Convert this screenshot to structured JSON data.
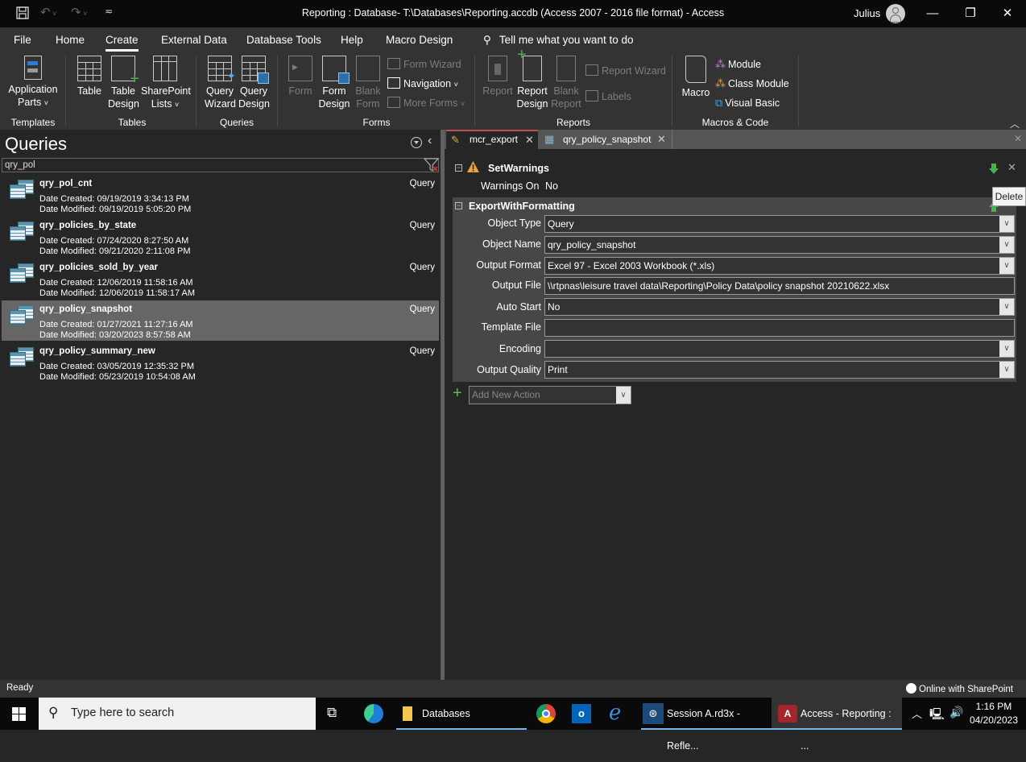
{
  "window": {
    "title": "Reporting : Database- T:\\Databases\\Reporting.accdb (Access 2007 - 2016 file format)  -  Access",
    "user": "Julius",
    "controls": {
      "minimize": "—",
      "restore": "❐",
      "close": "✕"
    }
  },
  "quick_access": {
    "save_icon": "save-icon",
    "undo_icon": "undo-icon",
    "redo_icon": "redo-icon",
    "customize_icon": "customize-qat-icon"
  },
  "ribbon_tabs": [
    {
      "label": "File",
      "active": false
    },
    {
      "label": "Home",
      "active": false
    },
    {
      "label": "Create",
      "active": true
    },
    {
      "label": "External Data",
      "active": false
    },
    {
      "label": "Database Tools",
      "active": false
    },
    {
      "label": "Help",
      "active": false
    },
    {
      "label": "Macro Design",
      "active": false
    }
  ],
  "tell_me": "Tell me what you want to do",
  "ribbon": {
    "groups": {
      "templates": "Templates",
      "tables": "Tables",
      "queries": "Queries",
      "forms": "Forms",
      "reports": "Reports",
      "macros": "Macros & Code"
    },
    "buttons": {
      "application_parts": [
        "Application",
        "Parts"
      ],
      "table": "Table",
      "table_design": [
        "Table",
        "Design"
      ],
      "sharepoint_lists": [
        "SharePoint",
        "Lists"
      ],
      "query_wizard": [
        "Query",
        "Wizard"
      ],
      "query_design": [
        "Query",
        "Design"
      ],
      "form": "Form",
      "form_design": [
        "Form",
        "Design"
      ],
      "blank_form": [
        "Blank",
        "Form"
      ],
      "form_wizard": "Form Wizard",
      "navigation": "Navigation",
      "more_forms": "More Forms",
      "report": "Report",
      "report_design": [
        "Report",
        "Design"
      ],
      "blank_report": [
        "Blank",
        "Report"
      ],
      "report_wizard": "Report Wizard",
      "labels": "Labels",
      "macro": "Macro",
      "module": "Module",
      "class_module": "Class Module",
      "visual_basic": "Visual Basic"
    }
  },
  "nav_pane": {
    "title": "Queries",
    "search_value": "qry_pol",
    "items": [
      {
        "name": "qry_pol_cnt",
        "type": "Query",
        "created": "Date Created: 09/19/2019 3:34:13 PM",
        "modified": "Date Modified: 09/19/2019 5:05:20 PM",
        "selected": false
      },
      {
        "name": "qry_policies_by_state",
        "type": "Query",
        "created": "Date Created: 07/24/2020 8:27:50 AM",
        "modified": "Date Modified: 09/21/2020 2:11:08 PM",
        "selected": false
      },
      {
        "name": "qry_policies_sold_by_year",
        "type": "Query",
        "created": "Date Created: 12/06/2019 11:58:16 AM",
        "modified": "Date Modified: 12/06/2019 11:58:17 AM",
        "selected": false
      },
      {
        "name": "qry_policy_snapshot",
        "type": "Query",
        "created": "Date Created: 01/27/2021 11:27:16 AM",
        "modified": "Date Modified: 03/20/2023 8:57:58 AM",
        "selected": true
      },
      {
        "name": "qry_policy_summary_new",
        "type": "Query",
        "created": "Date Created: 03/05/2019 12:35:32 PM",
        "modified": "Date Modified: 05/23/2019 10:54:08 AM",
        "selected": false
      }
    ]
  },
  "doc_tabs": [
    {
      "label": "mcr_export",
      "active": true
    },
    {
      "label": "qry_policy_snapshot",
      "active": false
    }
  ],
  "macro": {
    "set_warnings": {
      "action": "SetWarnings",
      "args": [
        {
          "label": "Warnings On",
          "value": "No"
        }
      ]
    },
    "export": {
      "action": "ExportWithFormatting",
      "args": [
        {
          "label": "Object Type",
          "value": "Query",
          "dropdown": true
        },
        {
          "label": "Object Name",
          "value": "qry_policy_snapshot",
          "dropdown": true
        },
        {
          "label": "Output Format",
          "value": "Excel 97 - Excel 2003 Workbook (*.xls)",
          "dropdown": true
        },
        {
          "label": "Output File",
          "value": "\\\\rtpnas\\leisure travel data\\Reporting\\Policy Data\\policy snapshot 20210622.xlsx",
          "dropdown": false
        },
        {
          "label": "Auto Start",
          "value": "No",
          "dropdown": true
        },
        {
          "label": "Template File",
          "value": "",
          "dropdown": false
        },
        {
          "label": "Encoding",
          "value": "",
          "dropdown": true
        },
        {
          "label": "Output Quality",
          "value": "Print",
          "dropdown": true
        }
      ]
    },
    "add_new_action_placeholder": "Add New Action",
    "tooltip": "Delete"
  },
  "status_bar": {
    "status": "Ready",
    "online": "Online with SharePoint"
  },
  "taskbar": {
    "search_placeholder": "Type here to search",
    "apps": [
      {
        "label": "Databases"
      },
      {
        "label": "Session A.rd3x - Refle..."
      },
      {
        "label": "Access - Reporting : ..."
      }
    ],
    "time": "1:16 PM",
    "date": "04/20/2023"
  }
}
